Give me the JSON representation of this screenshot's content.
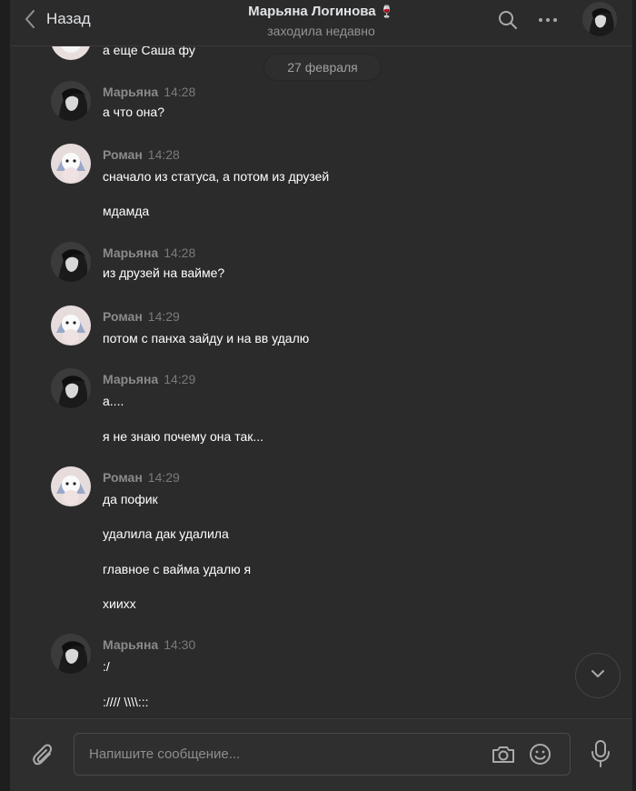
{
  "header": {
    "back_label": "Назад",
    "title": "Марьяна Логинова",
    "title_emoji": "🍷",
    "status": "заходила недавно",
    "icons": [
      "chevron-left-icon",
      "search-icon",
      "more-icon",
      "avatar"
    ]
  },
  "date_separator": "27 февраля",
  "previous_message": {
    "text": "а еще Саша фу"
  },
  "messages": [
    {
      "author": "Марьяна",
      "time": "14:28",
      "lines": [
        "а что она?"
      ]
    },
    {
      "author": "Роман",
      "time": "14:28",
      "lines": [
        "сначало из статуса, а потом из друзей",
        "мдамда"
      ]
    },
    {
      "author": "Марьяна",
      "time": "14:28",
      "lines": [
        "из друзей на вайме?"
      ]
    },
    {
      "author": "Роман",
      "time": "14:29",
      "lines": [
        "потом с панха зайду и на вв удалю"
      ]
    },
    {
      "author": "Марьяна",
      "time": "14:29",
      "lines": [
        "а....",
        "я не знаю почему она так..."
      ]
    },
    {
      "author": "Роман",
      "time": "14:29",
      "lines": [
        "да пофик",
        "удалила дак удалила",
        "главное с вайма удалю я",
        "хиихх"
      ]
    },
    {
      "author": "Марьяна",
      "time": "14:30",
      "lines": [
        ":/",
        "://// \\\\\\\\:::"
      ]
    }
  ],
  "composer": {
    "placeholder": "Напишите сообщение...",
    "icons": [
      "paperclip-icon",
      "camera-icon",
      "emoji-icon",
      "microphone-icon"
    ]
  },
  "colors": {
    "background": "#2b2b2b",
    "text": "#ffffff",
    "muted": "#8a8a8a"
  }
}
